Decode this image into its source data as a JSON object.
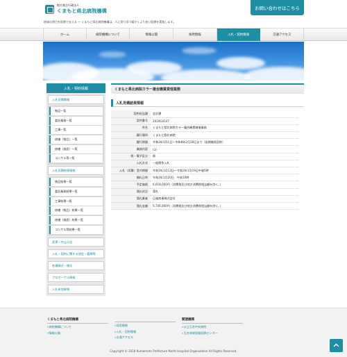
{
  "header": {
    "logo_sub": "地方独立行政法人",
    "logo_main": "くまもと県北病院機構",
    "tagline": "地域の明日を医療で支える ～ くまもと県北病院機構は、人に寄り添う暖かくより良い医療を実践します。",
    "contact_label": "お問い合わせはこちら"
  },
  "nav": {
    "items": [
      {
        "label": "ホーム"
      },
      {
        "label": "病院機構について"
      },
      {
        "label": "情報公開"
      },
      {
        "label": "採用情報"
      },
      {
        "label": "入札・契約情報"
      },
      {
        "label": "交通アクセス"
      }
    ],
    "active_index": 4
  },
  "sidebar": {
    "heading": "入札・契約情報",
    "sec1": "入札見積情報",
    "sec1_items": [
      "物品一覧",
      "委託業務一覧",
      "工事一覧",
      "修繕（物品）一覧",
      "修繕（施設）一覧",
      "コンサル等一覧"
    ],
    "sec2": "入札見積結果情報",
    "sec2_items": [
      "物品結果一覧",
      "委託業務結果一覧",
      "工事結果一覧",
      "修繕（物品）結果一覧",
      "修繕（施設）結果一覧",
      "コンサル等結果一覧"
    ],
    "other": [
      "変更・中止公告",
      "入札・契約に関する規定・要綱等",
      "各種様式・様式",
      "プロポーザル情報",
      "入札参加資格"
    ]
  },
  "content": {
    "page_title": "くまもと県北病院カラー複合機賃貸借業務",
    "section_title": "入札見積結果情報",
    "rows": [
      {
        "k": "契約担当課",
        "v": "会計課"
      },
      {
        "k": "案件番号",
        "v": "2020G0147"
      },
      {
        "k": "件名",
        "v": "くまもと県北病院カラー複合機賃貸借業務"
      },
      {
        "k": "履行場所",
        "v": "くまもと県北病院"
      },
      {
        "k": "履行期間",
        "v": "令和3年3月1日～令和8年2月28日まで（長期継続契約）"
      },
      {
        "k": "業務内容",
        "v": "(3)"
      },
      {
        "k": "紙・電子区分",
        "v": "紙"
      },
      {
        "k": "入札方式",
        "v": "一般競争入札"
      },
      {
        "k": "入札（見積）受付期間",
        "v": "令和3年1月13日～令和3年1月19日午後5時"
      },
      {
        "k": "開札日時",
        "v": "令和3年1月20日　午前10時"
      },
      {
        "k": "予定価格",
        "v": "6,018,000円（消費税及び地方消費税相当額を除く。）"
      },
      {
        "k": "落札状況",
        "v": "落札"
      },
      {
        "k": "落札業者",
        "v": "日進商事株式会社"
      },
      {
        "k": "落札金額",
        "v": "5,706,000円（消費税及び地方消費税相当額を除く。）"
      }
    ]
  },
  "footer": {
    "col1_heading": "くまもと県北病院機構",
    "col1_links": [
      "病院機構について",
      "情報公開"
    ],
    "col2_links": [
      "採用情報",
      "入札・契約情報",
      "交通アクセス"
    ],
    "col3_heading": "関連機関",
    "col3_links": [
      "公立玉名中央病院",
      "玉名地域保健医療センター"
    ],
    "copyright": "Copyright © 2018 Kumamoto Prefecture North Hospital Organization All Rights Reserved."
  },
  "icons": {
    "logo": "hospital-logo-icon",
    "footer_link": "double-chevron-right-icon",
    "page_top": "chevron-up-icon"
  },
  "colors": {
    "accent": "#1e8fa3",
    "sidebar_bg": "#e8e8e8",
    "footer_bg": "#f2f2f2"
  }
}
